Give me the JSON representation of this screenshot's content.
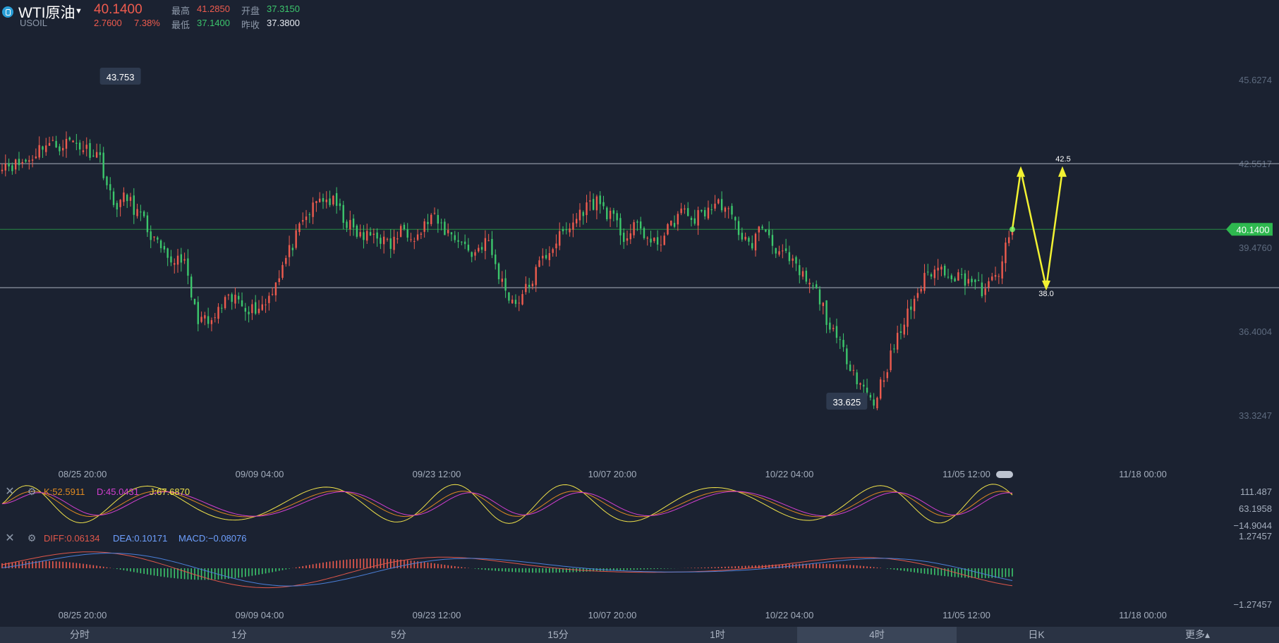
{
  "header": {
    "symbol": "WTI原油",
    "code": "USOIL",
    "price": "40.1400",
    "change": "2.7600",
    "change_pct": "7.38%",
    "high_label": "最高",
    "high": "41.2850",
    "open_label": "开盘",
    "open": "37.3150",
    "low_label": "最低",
    "low": "37.1400",
    "prev_label": "昨收",
    "prev_close": "37.3800"
  },
  "colors": {
    "up": "#ee5b4e",
    "down": "#3cc66c",
    "bg": "#1b2231",
    "k": "#e08a20",
    "d": "#d43fd1",
    "j": "#f0e24a",
    "diff": "#e0574a",
    "dea": "#4a7fd8",
    "arrow": "#f2f232"
  },
  "price_axis": [
    "45.6274",
    "42.5517",
    "39.4760",
    "36.4004",
    "33.3247"
  ],
  "time_axis": [
    "08/25 20:00",
    "09/09 04:00",
    "09/23 12:00",
    "10/07 20:00",
    "10/22 04:00",
    "11/05 12:00",
    "11/18 00:00"
  ],
  "last_price_tag": "40.1400",
  "max_label": "43.753",
  "min_label": "33.625",
  "kdj": {
    "k": "K:52.5911",
    "d": "D:45.0431",
    "j": "J:67.6870",
    "axis": [
      "111.487",
      "63.1958",
      "−14.9044"
    ]
  },
  "macd": {
    "diff": "DIFF:0.06134",
    "dea": "DEA:0.10171",
    "macd": "MACD:−0.08076",
    "axis": [
      "1.27457",
      "−1.27457"
    ]
  },
  "tabs": [
    {
      "label": "分时",
      "active": false
    },
    {
      "label": "1分",
      "active": false
    },
    {
      "label": "5分",
      "active": false
    },
    {
      "label": "15分",
      "active": false
    },
    {
      "label": "1时",
      "active": false
    },
    {
      "label": "4时",
      "active": true
    },
    {
      "label": "日K",
      "active": false
    },
    {
      "label": "更多▴",
      "active": false
    }
  ],
  "chart_data": {
    "type": "candlestick",
    "instrument": "WTI原油 USOIL",
    "timeframe": "4时",
    "ylim": [
      32.0,
      47.0
    ],
    "price_ticks": [
      45.6274,
      42.5517,
      39.476,
      36.4004,
      33.3247
    ],
    "time_ticks": [
      "08/25 20:00",
      "09/09 04:00",
      "09/23 12:00",
      "10/07 20:00",
      "10/22 04:00",
      "11/05 12:00",
      "11/18 00:00"
    ],
    "path_close": [
      42.6,
      42.5,
      42.7,
      43.3,
      43.2,
      43.4,
      43.1,
      42.9,
      41.0,
      41.3,
      40.6,
      39.7,
      38.9,
      39.2,
      37.0,
      36.6,
      37.4,
      37.6,
      37.2,
      37.4,
      38.5,
      39.6,
      40.6,
      41.3,
      41.1,
      40.3,
      39.8,
      40.0,
      39.5,
      40.2,
      39.9,
      40.6,
      40.1,
      39.8,
      39.2,
      39.8,
      38.3,
      37.4,
      38.0,
      39.0,
      39.7,
      40.2,
      40.9,
      41.2,
      40.6,
      39.8,
      40.3,
      39.5,
      40.0,
      40.8,
      40.5,
      40.9,
      41.1,
      40.3,
      39.5,
      40.3,
      39.4,
      38.9,
      38.3,
      37.7,
      36.3,
      35.5,
      34.5,
      33.8,
      35.2,
      36.5,
      37.7,
      38.6,
      38.7,
      38.4,
      38.3,
      37.8,
      38.6,
      40.14
    ],
    "horizontal_levels": [
      42.55,
      40.14,
      38.0
    ],
    "annotations": [
      "42.5",
      "38.0"
    ],
    "projection_path": [
      [
        40.14,
        "now"
      ],
      [
        42.3,
        "up"
      ],
      [
        38.0,
        "down"
      ],
      [
        42.3,
        "up"
      ]
    ]
  }
}
